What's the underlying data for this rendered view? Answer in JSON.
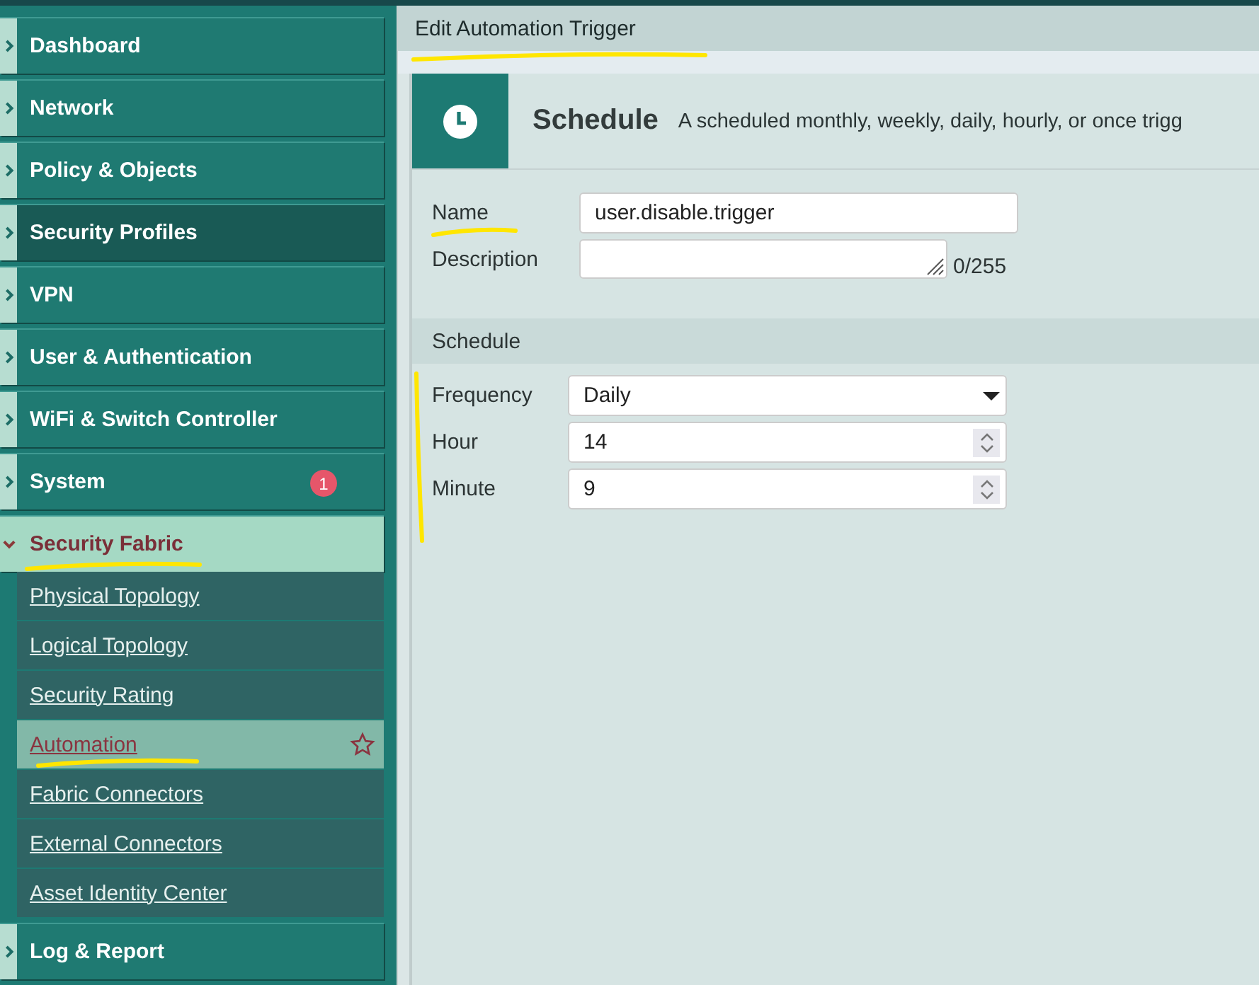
{
  "sidebar": {
    "items": [
      {
        "label": "Dashboard",
        "selected": false,
        "expanded": false
      },
      {
        "label": "Network",
        "selected": false,
        "expanded": false
      },
      {
        "label": "Policy & Objects",
        "selected": false,
        "expanded": false
      },
      {
        "label": "Security Profiles",
        "selected": true,
        "expanded": false
      },
      {
        "label": "VPN",
        "selected": false,
        "expanded": false
      },
      {
        "label": "User & Authentication",
        "selected": false,
        "expanded": false
      },
      {
        "label": "WiFi & Switch Controller",
        "selected": false,
        "expanded": false
      },
      {
        "label": "System",
        "selected": false,
        "expanded": false,
        "badge": "1"
      },
      {
        "label": "Security Fabric",
        "selected": false,
        "expanded": true,
        "underlined": true,
        "children": [
          {
            "label": "Physical Topology",
            "selected": false
          },
          {
            "label": "Logical Topology",
            "selected": false
          },
          {
            "label": "Security Rating",
            "selected": false
          },
          {
            "label": "Automation",
            "selected": true,
            "underlined": true
          },
          {
            "label": "Fabric Connectors",
            "selected": false
          },
          {
            "label": "External Connectors",
            "selected": false
          },
          {
            "label": "Asset Identity Center",
            "selected": false
          }
        ]
      },
      {
        "label": "Log & Report",
        "selected": false,
        "expanded": false
      }
    ]
  },
  "page": {
    "title": "Edit Automation Trigger",
    "underlined": true
  },
  "trigger": {
    "name": "Schedule",
    "description": "A scheduled monthly, weekly, daily, hourly, or once trigg"
  },
  "form": {
    "fields": [
      {
        "label": "Name",
        "value": "user.disable.trigger",
        "underlined": true
      },
      {
        "label": "Description",
        "counter": "0/255"
      }
    ]
  },
  "schedule": {
    "heading": "Schedule",
    "bracketed": true,
    "fields": [
      {
        "kind": "select",
        "label": "Frequency",
        "value": "Daily"
      },
      {
        "kind": "number",
        "label": "Hour",
        "value": "14"
      },
      {
        "kind": "number",
        "label": "Minute",
        "value": "9"
      }
    ]
  }
}
